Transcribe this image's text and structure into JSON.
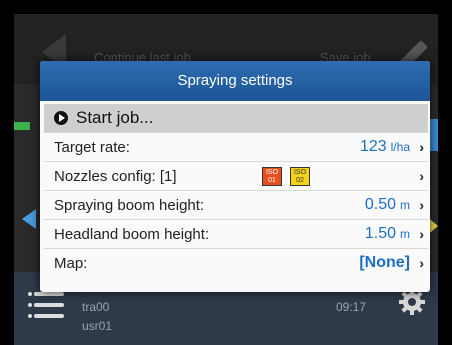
{
  "background": {
    "top_actions": {
      "continue_label": "Continue last job",
      "save_label": "Save job"
    },
    "bottom_bar": {
      "line1": "tra00",
      "line2": "usr01",
      "time": "09:17"
    }
  },
  "dialog": {
    "title": "Spraying settings",
    "start_job": "Start job...",
    "rows": [
      {
        "label": "Target rate:",
        "value": "123",
        "unit": "l/ha"
      },
      {
        "label": "Nozzles config: [1]",
        "badges": [
          "ISO 01",
          "ISO 02"
        ],
        "badge_colors": [
          "#e8501f",
          "#f2d21a"
        ]
      },
      {
        "label": "Spraying boom height:",
        "value": "0.50",
        "unit": "m"
      },
      {
        "label": "Headland boom height:",
        "value": "1.50",
        "unit": "m"
      },
      {
        "label": "Map:",
        "value": "[None]"
      }
    ],
    "chevron": "›"
  },
  "colors": {
    "header_blue": "#1d5596",
    "value_blue": "#1d6fc4",
    "bottom_bar": "#2e3a4a"
  }
}
